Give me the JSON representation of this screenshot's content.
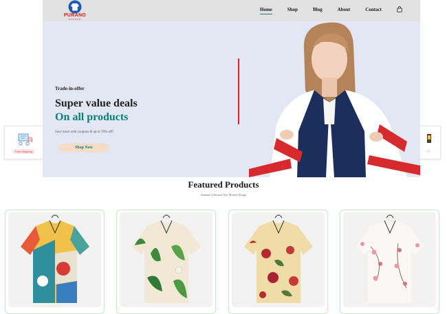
{
  "brand": {
    "name": "PURANO",
    "tagline": "SOURCE"
  },
  "nav": {
    "links": [
      "Home",
      "Shop",
      "Blog",
      "About",
      "Contact"
    ],
    "active": "Home",
    "cart_icon": "shopping-bag-icon"
  },
  "hero": {
    "eyebrow": "Trade-in-offer",
    "headline_1": "Super value deals",
    "headline_2": "On all products",
    "subtext": "Save more with coupons & up to 70% off!",
    "button_label": "Shop Now"
  },
  "features": [
    {
      "icon": "shipping-icon",
      "label": "Free Shipping"
    },
    {
      "icon": "support-icon",
      "label": ""
    }
  ],
  "featured": {
    "title": "Featured Products",
    "subtitle": "Summer Collection New Modern Design"
  },
  "products": [
    {
      "name": "patchwork-print-shirt"
    },
    {
      "name": "tropical-leaf-shirt"
    },
    {
      "name": "floral-print-shirt"
    },
    {
      "name": "blossom-print-shirt"
    }
  ],
  "colors": {
    "accent": "#088178",
    "hero_bg": "#e3e6f3",
    "nav_bg": "#e2e2e2",
    "logo_red": "#c7211f"
  }
}
